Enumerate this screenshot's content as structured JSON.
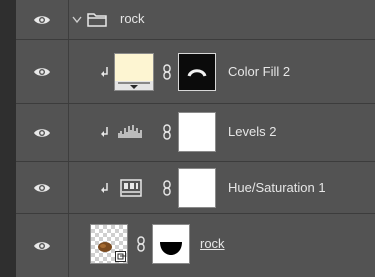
{
  "layers": {
    "group": {
      "name": "rock"
    },
    "color_fill": {
      "name": "Color Fill 2",
      "fill_color": "#fdf5d2"
    },
    "levels": {
      "name": "Levels 2"
    },
    "hue_saturation": {
      "name": "Hue/Saturation 1"
    },
    "rock": {
      "name": "rock"
    }
  },
  "icons": {
    "visibility": "eye-icon",
    "expand": "chevron-down-icon",
    "folder": "folder-icon",
    "clip": "clipping-arrow-icon",
    "link": "chain-link-icon"
  }
}
